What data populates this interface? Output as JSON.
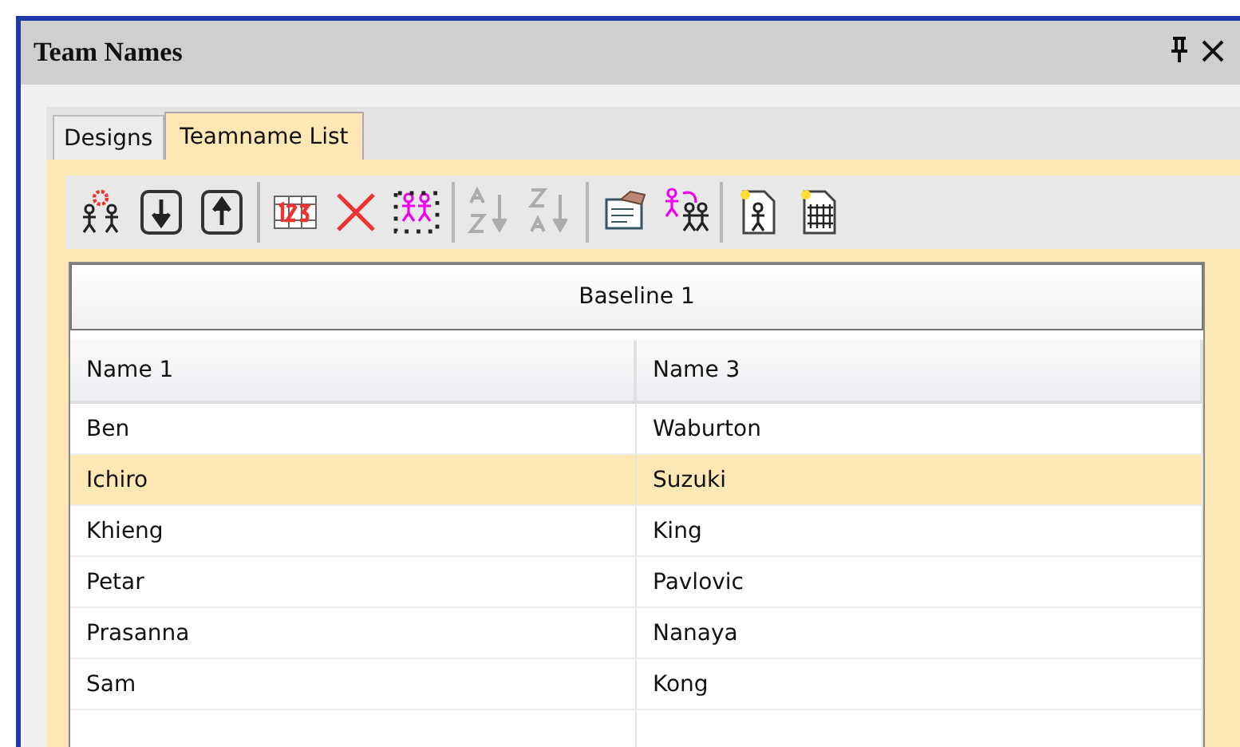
{
  "window": {
    "title": "Team Names"
  },
  "tabs": [
    {
      "label": "Designs",
      "selected": false
    },
    {
      "label": "Teamname List",
      "selected": true
    }
  ],
  "toolbar": [
    [
      {
        "kind": "people-gear",
        "disabled": false
      },
      {
        "kind": "down",
        "disabled": false
      },
      {
        "kind": "up",
        "disabled": false
      }
    ],
    [
      {
        "kind": "grid",
        "disabled": false
      },
      {
        "kind": "delete",
        "disabled": false
      },
      {
        "kind": "select-people",
        "disabled": false
      }
    ],
    [
      {
        "kind": "sort-asc",
        "disabled": true
      },
      {
        "kind": "sort-desc",
        "disabled": true
      }
    ],
    [
      {
        "kind": "card-hand",
        "disabled": false
      },
      {
        "kind": "people-arrow",
        "disabled": false
      }
    ],
    [
      {
        "kind": "page-person",
        "disabled": false
      },
      {
        "kind": "page-people",
        "disabled": false
      }
    ]
  ],
  "table": {
    "group_header": "Baseline 1",
    "columns": [
      "Name 1",
      "Name 3"
    ],
    "rows": [
      {
        "cells": [
          "Ben",
          "Waburton"
        ],
        "selected": false
      },
      {
        "cells": [
          "Ichiro",
          "Suzuki"
        ],
        "selected": true
      },
      {
        "cells": [
          "Khieng",
          "King"
        ],
        "selected": false
      },
      {
        "cells": [
          "Petar",
          "Pavlovic"
        ],
        "selected": false
      },
      {
        "cells": [
          "Prasanna",
          "Nanaya"
        ],
        "selected": false
      },
      {
        "cells": [
          "Sam",
          "Kong"
        ],
        "selected": false
      }
    ]
  }
}
